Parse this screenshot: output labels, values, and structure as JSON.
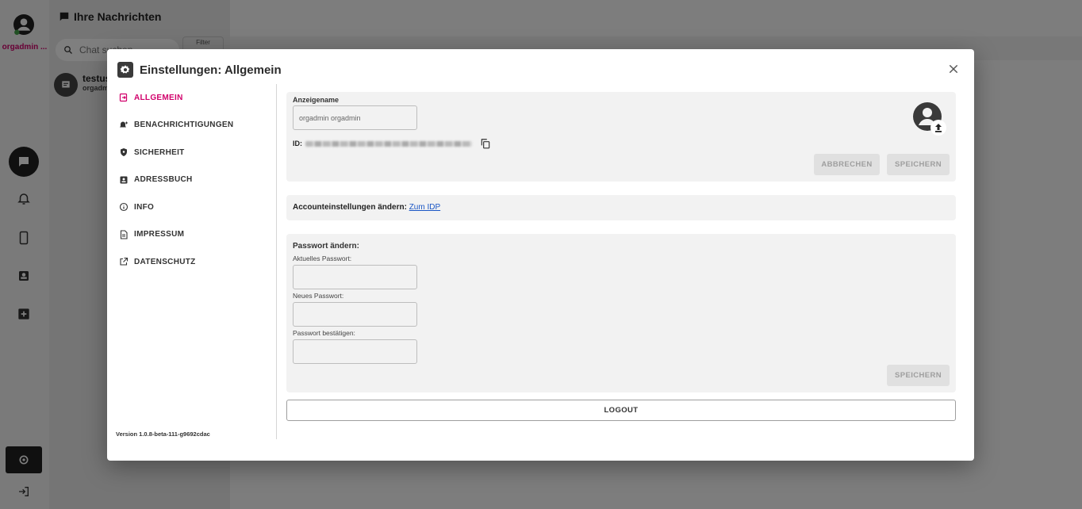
{
  "app": {
    "user_name": "orgadmin ...",
    "chats_title": "Ihre Nachrichten",
    "search_placeholder": "Chat suchen",
    "filter_label": "Filter",
    "chat_item": {
      "title": "testus",
      "subtitle": "orgadm"
    }
  },
  "dialog": {
    "title": "Einstellungen: Allgemein",
    "nav": [
      {
        "label": "ALLGEMEIN",
        "icon": "account-box-icon",
        "active": true
      },
      {
        "label": "BENACHRICHTIGUNGEN",
        "icon": "bell-plus-icon"
      },
      {
        "label": "SICHERHEIT",
        "icon": "shield-icon"
      },
      {
        "label": "ADRESSBUCH",
        "icon": "contacts-icon"
      },
      {
        "label": "INFO",
        "icon": "info-icon"
      },
      {
        "label": "IMPRESSUM",
        "icon": "document-icon"
      },
      {
        "label": "DATENSCHUTZ",
        "icon": "external-link-icon"
      }
    ],
    "version": "Version 1.0.8-beta-111-g9692cdac",
    "profile": {
      "display_name_label": "Anzeigename",
      "display_name_value": "orgadmin orgadmin",
      "id_label": "ID:",
      "cancel_label": "ABBRECHEN",
      "save_label": "SPEICHERN"
    },
    "account": {
      "text": "Accounteinstellungen ändern:",
      "link": "Zum IDP"
    },
    "password": {
      "title": "Passwort ändern:",
      "current_label": "Aktuelles Passwort:",
      "new_label": "Neues Passwort:",
      "confirm_label": "Passwort bestätigen:",
      "save_label": "SPEICHERN"
    },
    "logout_label": "LOGOUT"
  },
  "colors": {
    "accent": "#d1006b",
    "link": "#1a56c5",
    "dark": "#212121"
  }
}
